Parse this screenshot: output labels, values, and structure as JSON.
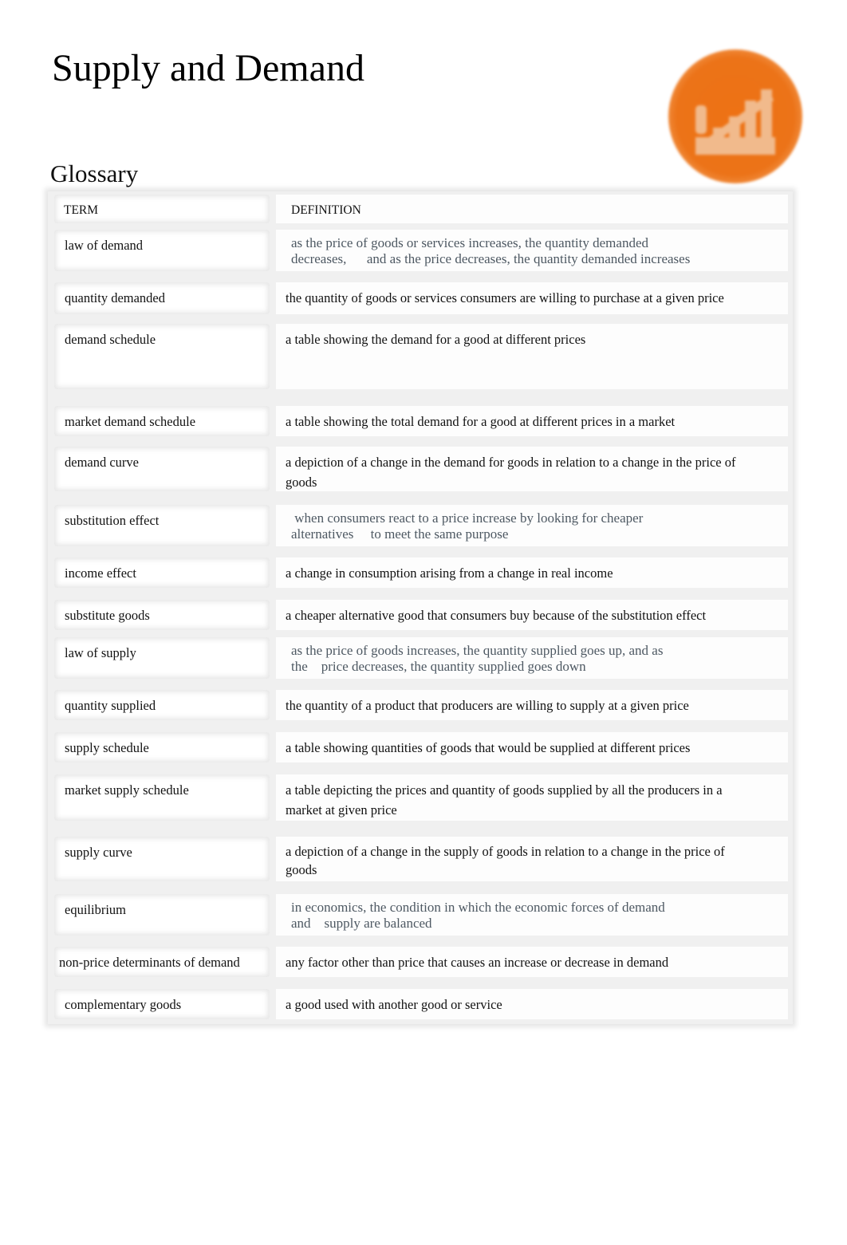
{
  "page": {
    "title": "Supply and Demand",
    "logo_icon": "chart-growth-icon",
    "accent_color": "#ec7318"
  },
  "glossary": {
    "heading": "Glossary",
    "columns": [
      "TERM",
      "DEFINITION"
    ],
    "rows": [
      {
        "term": "law of demand",
        "definition_line1": "as the price of goods or services increases, the quantity demanded",
        "definition_line2": "decreases,      and as the price decreases, the quantity demanded increases"
      },
      {
        "term": "quantity demanded",
        "definition_line1": "the quantity of goods or services consumers are willing to purchase at a given price",
        "definition_line2": ""
      },
      {
        "term": "demand schedule",
        "definition_line1": "a table showing the demand for a good at different prices",
        "definition_line2": ""
      },
      {
        "term": "market demand schedule",
        "definition_line1": "a table showing the total demand for a good at different prices in a market",
        "definition_line2": ""
      },
      {
        "term": "demand curve",
        "definition_line1": "a depiction of a change in the demand for goods in relation to a change in the price of",
        "definition_line2": "goods"
      },
      {
        "term": "substitution effect",
        "definition_line1": " when consumers react to a price increase by looking for cheaper",
        "definition_line2": "alternatives     to meet the same purpose"
      },
      {
        "term": "income effect",
        "definition_line1": "a change in consumption arising from a change in real income",
        "definition_line2": ""
      },
      {
        "term": "substitute goods",
        "definition_line1": "a cheaper alternative good that consumers buy because of the substitution effect",
        "definition_line2": ""
      },
      {
        "term": "law of supply",
        "definition_line1": "as the price of goods increases, the quantity supplied goes up, and as",
        "definition_line2": "the    price decreases, the quantity supplied goes down"
      },
      {
        "term": "quantity supplied",
        "definition_line1": "the quantity of a product that producers are willing to supply at a given price",
        "definition_line2": ""
      },
      {
        "term": "supply schedule",
        "definition_line1": "a table showing quantities of goods that would be supplied at different prices",
        "definition_line2": ""
      },
      {
        "term": "market supply schedule",
        "definition_line1": "a table depicting the prices and quantity of goods supplied by all the producers in a",
        "definition_line2": "market at given price"
      },
      {
        "term": "supply curve",
        "definition_line1": "a depiction of a change in the supply of goods in relation to a change in the price of",
        "definition_line2": "goods"
      },
      {
        "term": "equilibrium",
        "definition_line1": "in economics, the condition in which the economic forces of demand",
        "definition_line2": "and    supply are balanced"
      },
      {
        "term": "non-price determinants of demand",
        "definition_line1": "any factor other than price that causes an increase or decrease in demand",
        "definition_line2": ""
      },
      {
        "term": "complementary goods",
        "definition_line1": "a good used with another good or service",
        "definition_line2": ""
      }
    ]
  }
}
